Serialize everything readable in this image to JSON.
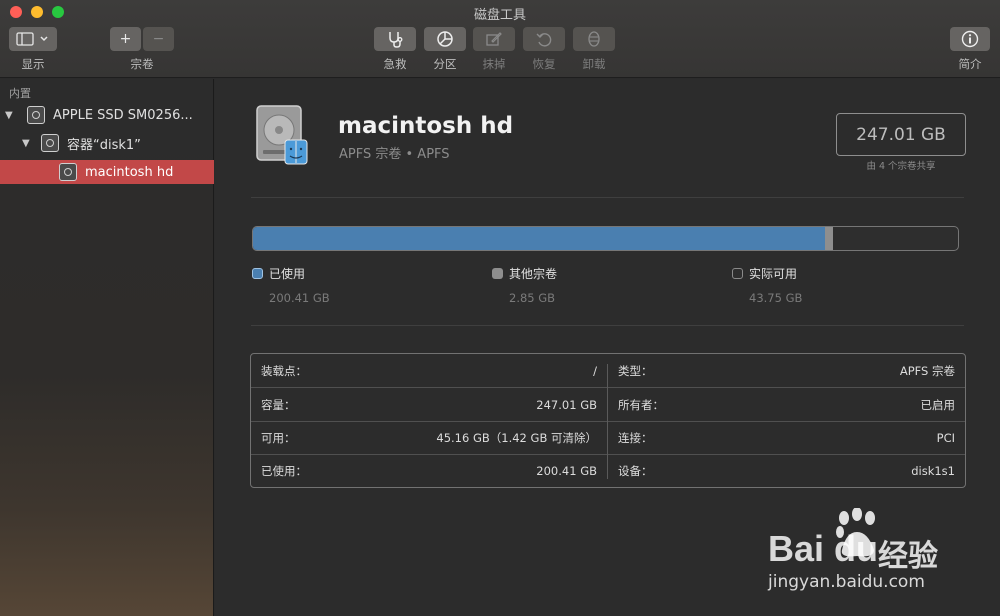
{
  "window": {
    "title": "磁盘工具"
  },
  "toolbar": {
    "display_label": "显示",
    "volume_label": "宗卷",
    "add_glyph": "+",
    "remove_glyph": "−",
    "firstaid_label": "急救",
    "partition_label": "分区",
    "erase_label": "抹掉",
    "restore_label": "恢复",
    "unmount_label": "卸载",
    "info_label": "简介"
  },
  "sidebar": {
    "section": "内置",
    "items": [
      {
        "label": "APPLE SSD SM0256...",
        "icon": "internal-disk-icon"
      },
      {
        "label": "容器“disk1”",
        "icon": "container-icon"
      },
      {
        "label": "macintosh hd",
        "icon": "volume-icon",
        "selected": true
      }
    ]
  },
  "volume": {
    "name": "macintosh hd",
    "subtitle": "APFS 宗卷 • APFS",
    "capacity": "247.01 GB",
    "shared_note": "由 4 个宗卷共享"
  },
  "usage": {
    "used_fraction": 0.8114,
    "other_fraction": 0.0115,
    "colors": {
      "used": "#4a7fb0",
      "other": "#8e8e8e",
      "free": "#2e2e2e"
    },
    "legend": [
      {
        "label": "已使用",
        "value": "200.41 GB",
        "color": "#4a7fb0"
      },
      {
        "label": "其他宗卷",
        "value": "2.85 GB",
        "color": "#8e8e8e"
      },
      {
        "label": "实际可用",
        "value": "43.75 GB",
        "color": "#2e2e2e"
      }
    ]
  },
  "info": {
    "left": [
      {
        "key": "装载点：",
        "value": "/"
      },
      {
        "key": "容量：",
        "value": "247.01 GB"
      },
      {
        "key": "可用：",
        "value": "45.16 GB（1.42 GB 可清除）"
      },
      {
        "key": "已使用：",
        "value": "200.41 GB"
      }
    ],
    "right": [
      {
        "key": "类型：",
        "value": "APFS 宗卷"
      },
      {
        "key": "所有者：",
        "value": "已启用"
      },
      {
        "key": "连接：",
        "value": "PCI"
      },
      {
        "key": "设备：",
        "value": "disk1s1"
      }
    ]
  },
  "watermark": {
    "brand": "Bai du",
    "suffix": "经验",
    "url": "jingyan.baidu.com"
  }
}
